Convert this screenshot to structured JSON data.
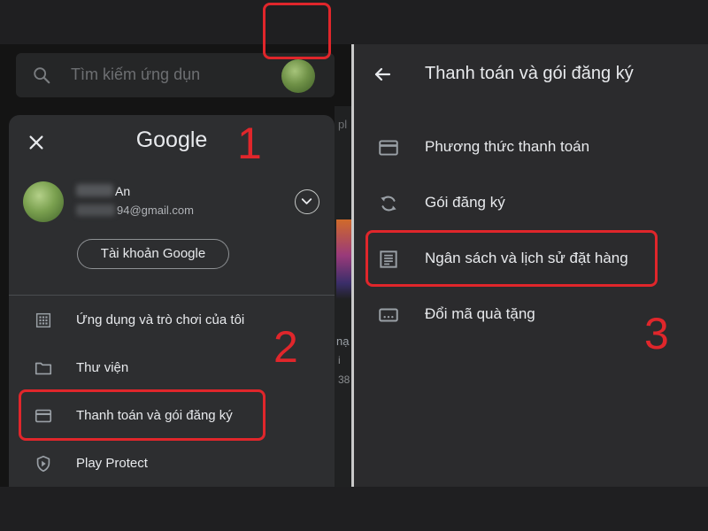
{
  "colors": {
    "accent_red": "#e0262b",
    "panel_dark": "#141414",
    "card": "#2d2e30",
    "right_panel": "#2b2b2d",
    "text": "#e8eaed"
  },
  "search": {
    "placeholder": "Tìm kiếm ứng dụn",
    "icon": "search-icon"
  },
  "backdrop": {
    "frag1": "pl",
    "frag2": "nạ",
    "frag3": "i",
    "frag4": "38"
  },
  "account_menu": {
    "brand": "Google",
    "user_name": "An",
    "user_email": "94@gmail.com",
    "manage_button": "Tài khoản Google",
    "items": [
      {
        "label": "Ứng dụng và trò chơi của tôi",
        "icon": "apps-grid-icon"
      },
      {
        "label": "Thư viện",
        "icon": "folder-icon"
      },
      {
        "label": "Thanh toán và gói đăng ký",
        "icon": "credit-card-icon"
      },
      {
        "label": "Play Protect",
        "icon": "shield-play-icon"
      }
    ]
  },
  "payments_screen": {
    "title": "Thanh toán và gói đăng ký",
    "items": [
      {
        "label": "Phương thức thanh toán",
        "icon": "credit-card-icon"
      },
      {
        "label": "Gói đăng ký",
        "icon": "sync-icon"
      },
      {
        "label": "Ngân sách và lịch sử đặt hàng",
        "icon": "receipt-icon"
      },
      {
        "label": "Đổi mã quà tặng",
        "icon": "redeem-icon"
      }
    ]
  },
  "annotations": {
    "step1": "1",
    "step2": "2",
    "step3": "3"
  }
}
